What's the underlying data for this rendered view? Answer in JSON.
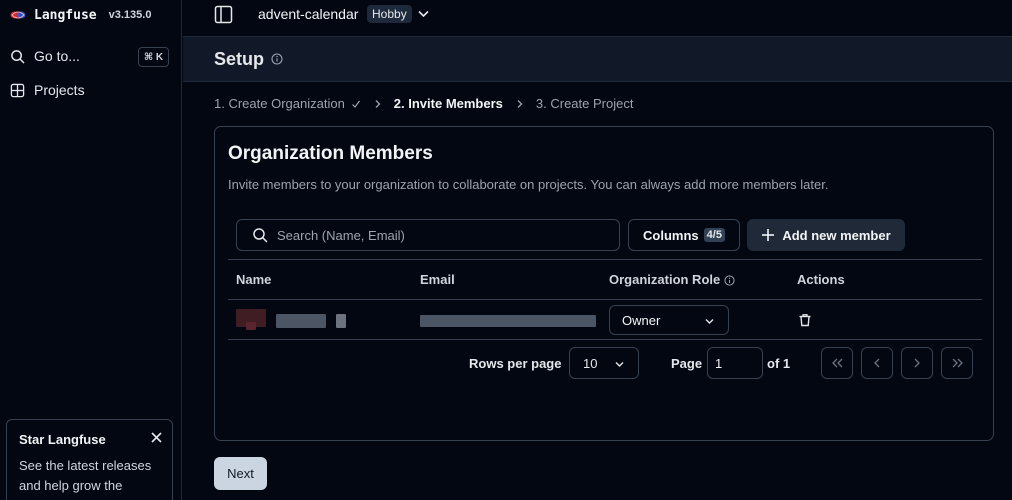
{
  "brand": {
    "name": "Langfuse",
    "version": "v3.135.0"
  },
  "sidebar": {
    "goto_label": "Go to...",
    "goto_shortcut": "⌘ K",
    "projects_label": "Projects",
    "promo": {
      "title": "Star Langfuse",
      "text": "See the latest releases and help grow the community"
    }
  },
  "topbar": {
    "project": "advent-calendar",
    "plan_badge": "Hobby"
  },
  "page": {
    "title": "Setup",
    "steps": [
      "1. Create Organization",
      "2. Invite Members",
      "3. Create Project"
    ],
    "current_step": 1
  },
  "card": {
    "title": "Organization Members",
    "description": "Invite members to your organization to collaborate on projects. You can always add more members later.",
    "search_placeholder": "Search (Name, Email)",
    "columns_label": "Columns",
    "columns_count": "4/5",
    "add_member_label": "Add new member",
    "headers": {
      "name": "Name",
      "email": "Email",
      "role": "Organization Role",
      "actions": "Actions"
    },
    "rows": [
      {
        "role": "Owner"
      }
    ]
  },
  "pagination": {
    "rows_per_page_label": "Rows per page",
    "rows_per_page_value": "10",
    "page_label": "Page",
    "page_value": "1",
    "of_label": "of 1"
  },
  "next_label": "Next"
}
